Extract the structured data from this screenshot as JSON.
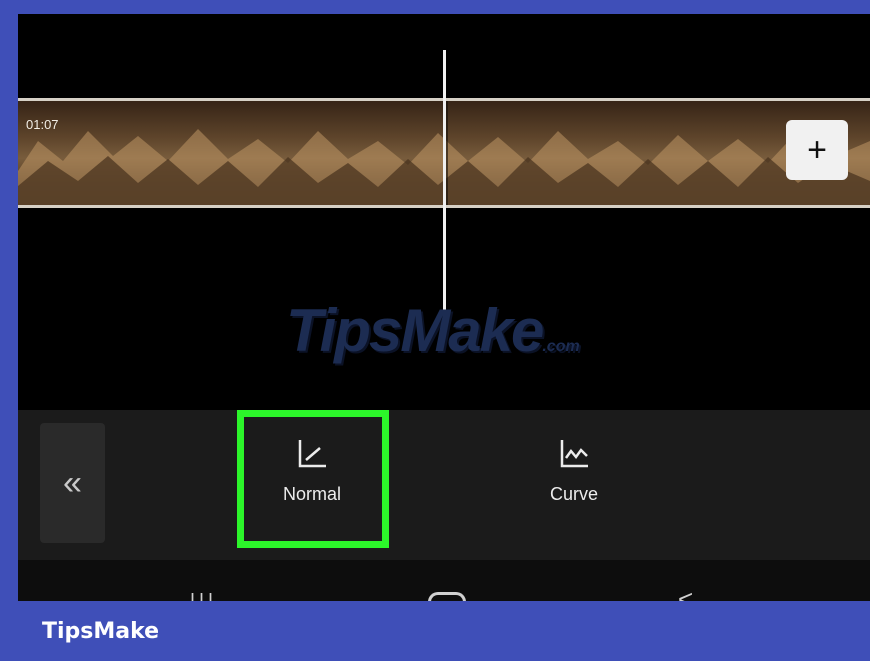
{
  "timeline": {
    "timecode": "01:07",
    "add_icon": "plus-icon",
    "add_label": "+"
  },
  "watermark": {
    "text": "TipsMake",
    "suffix": ".com"
  },
  "speed_panel": {
    "back_icon": "double-chevron-left-icon",
    "back_label": "«",
    "options": [
      {
        "label": "Normal",
        "icon": "normal-speed-icon",
        "selected": true
      },
      {
        "label": "Curve",
        "icon": "curve-speed-icon",
        "selected": false
      }
    ],
    "highlight_color": "#2cf52a"
  },
  "navbar": {
    "recent_label": "III",
    "home_icon": "home-icon",
    "back_label": "<"
  },
  "footer": {
    "brand": "TipsMake",
    "color": "#3f4fb8"
  }
}
